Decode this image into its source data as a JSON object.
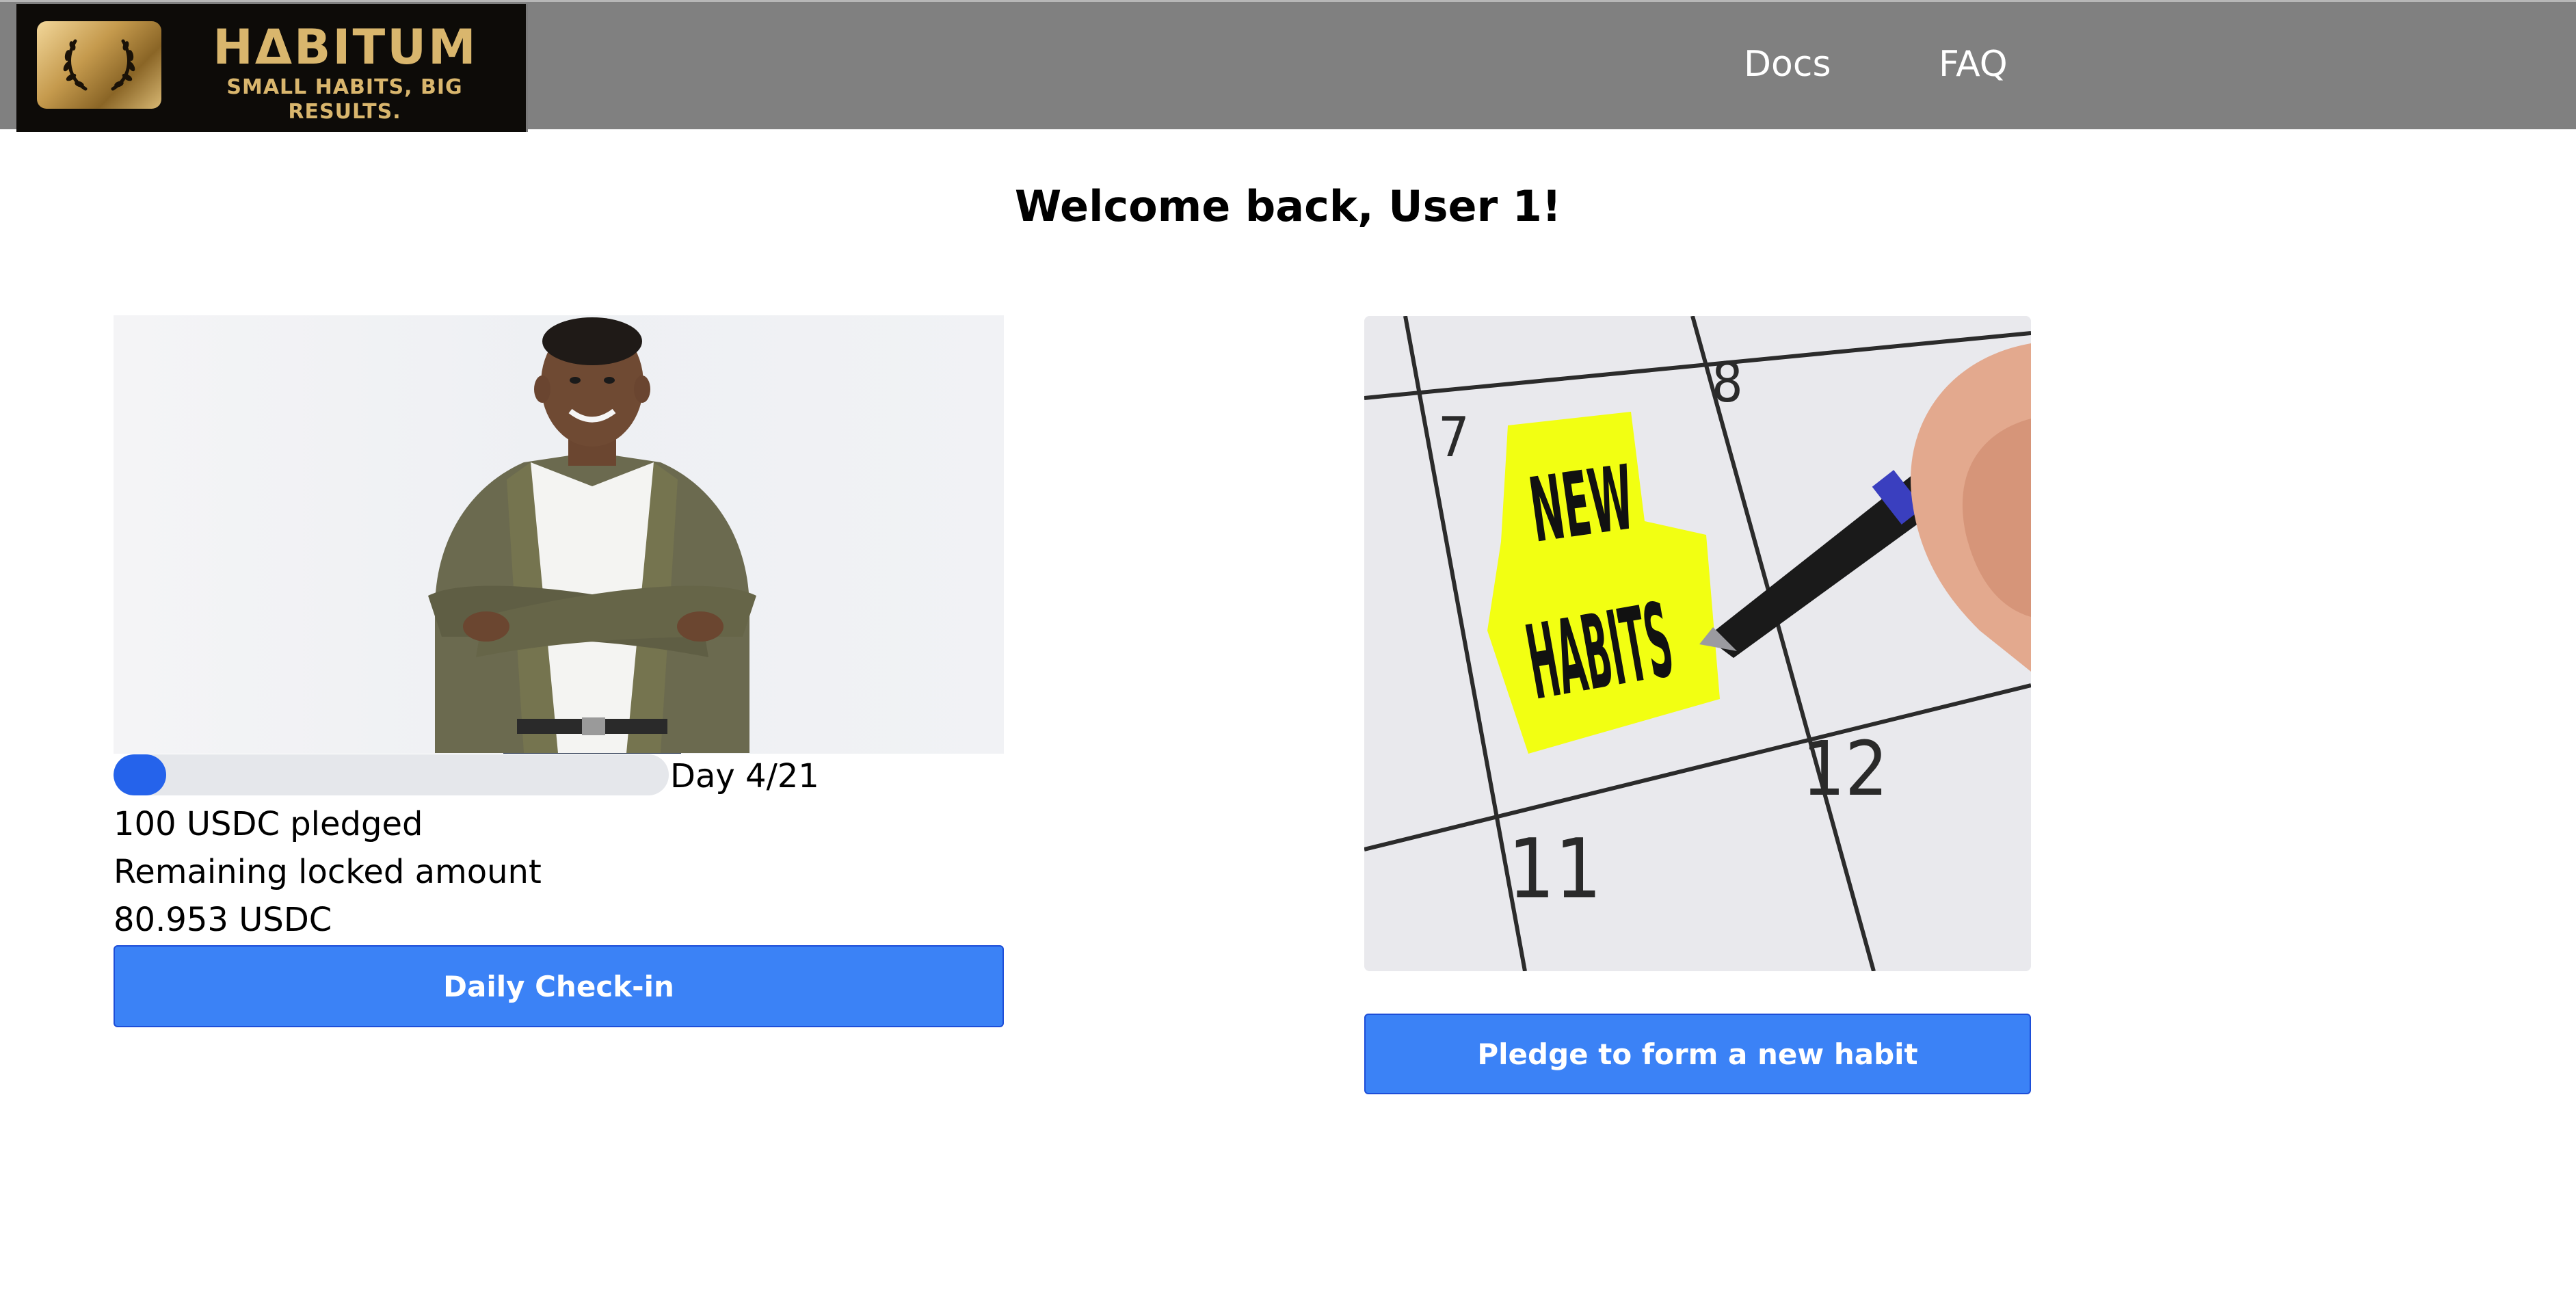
{
  "header": {
    "logo": {
      "title": "HΔBITUM",
      "tagline": "SMALL HABITS, BIG RESULTS."
    },
    "nav": [
      {
        "label": "Docs"
      },
      {
        "label": "FAQ"
      }
    ]
  },
  "main": {
    "welcome": "Welcome back, User 1!",
    "active_habit": {
      "progress_fraction": 0.095,
      "day_label": "Day 4/21",
      "pledged": "100 USDC pledged",
      "remaining_label": "Remaining locked amount",
      "remaining_value": "80.953 USDC",
      "checkin_button": "Daily Check-in"
    },
    "new_habit": {
      "image_text": [
        "NEW",
        "HABITS"
      ],
      "calendar_numbers": [
        "7",
        "8",
        "11",
        "12"
      ],
      "pledge_button": "Pledge to form a new habit"
    }
  },
  "colors": {
    "header_bg": "#808080",
    "accent": "#3b82f6",
    "progress_fill": "#2563eb",
    "progress_track": "#e5e7eb",
    "logo_gold": "#d9b66d"
  }
}
